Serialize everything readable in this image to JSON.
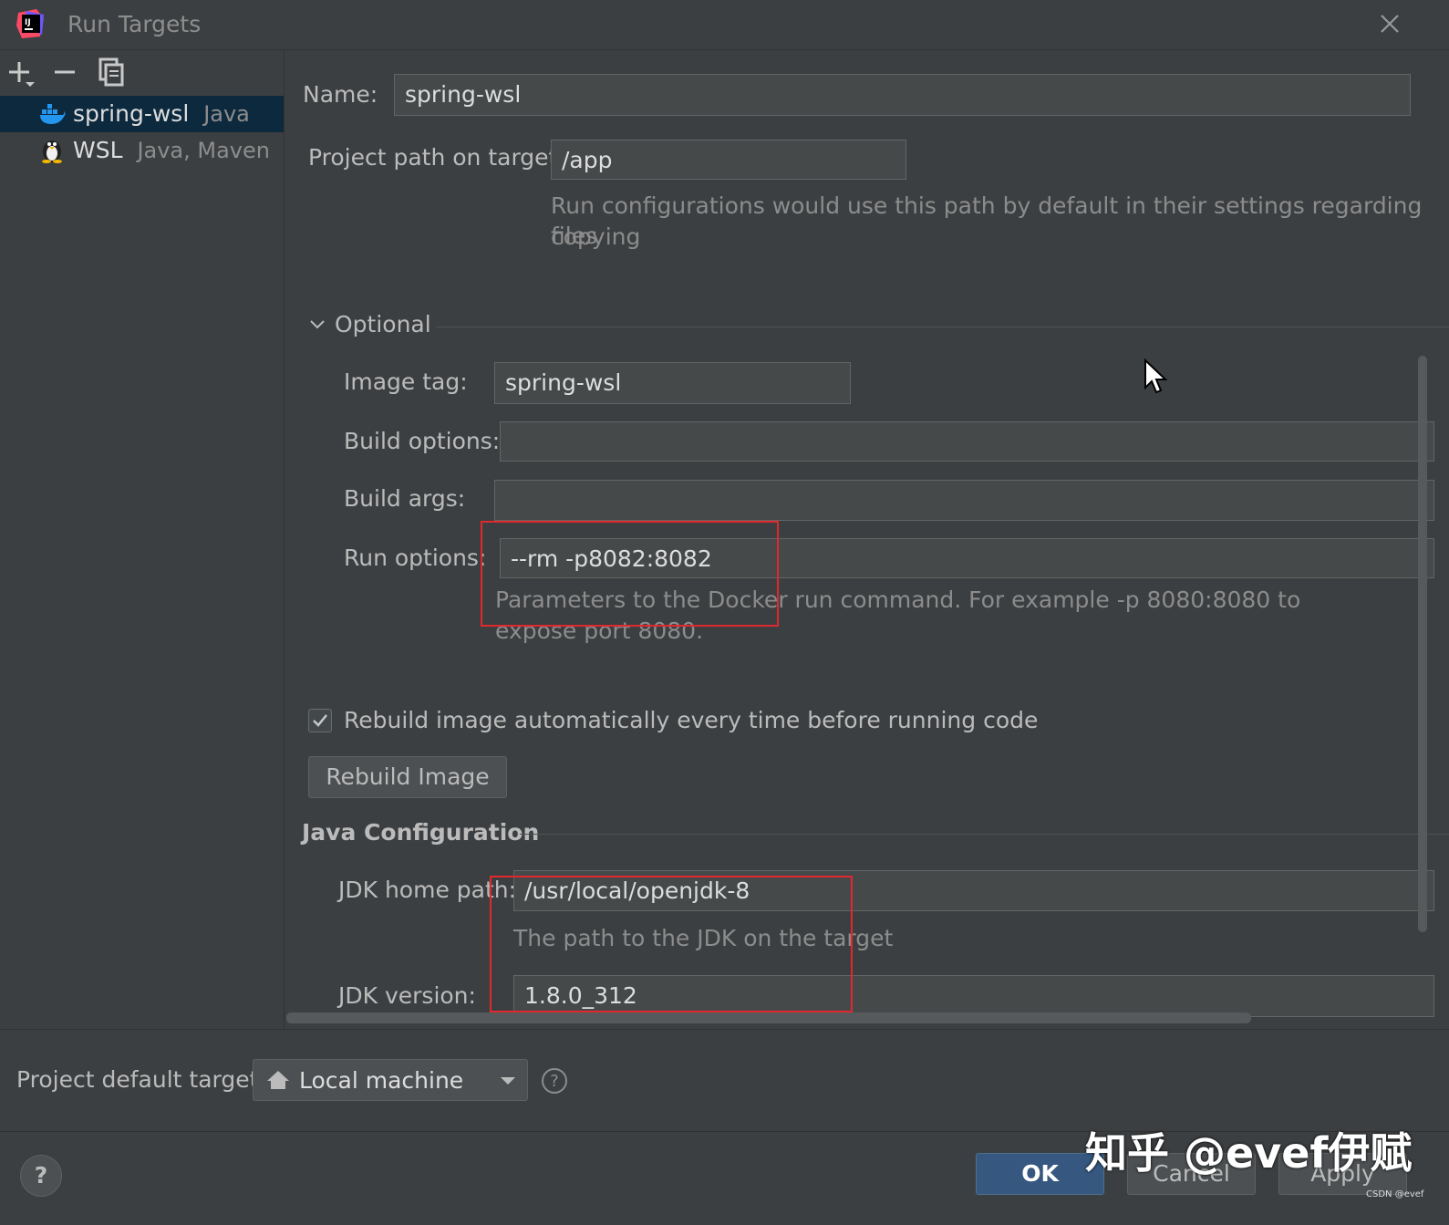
{
  "window": {
    "title": "Run Targets"
  },
  "toolbar": {
    "add": "add-icon",
    "remove": "remove-icon",
    "copy": "copy-icon"
  },
  "targets": [
    {
      "name": "spring-wsl",
      "type": "Java",
      "icon": "docker-icon",
      "selected": true
    },
    {
      "name": "WSL",
      "type": "Java, Maven",
      "icon": "linux-penguin-icon",
      "selected": false
    }
  ],
  "form": {
    "name_label": "Name:",
    "name_value": "spring-wsl",
    "project_path_label": "Project path on target:",
    "project_path_value": "/app",
    "project_path_hint_line1": "Run configurations would use this path by default in their settings regarding copying",
    "project_path_hint_line2": "files",
    "optional_label": "Optional",
    "image_tag_label": "Image tag:",
    "image_tag_value": "spring-wsl",
    "build_options_label": "Build options:",
    "build_options_value": "",
    "build_args_label": "Build args:",
    "build_args_value": "",
    "run_options_label": "Run options:",
    "run_options_value": "--rm  -p8082:8082",
    "run_options_hint_line1": "Parameters to the Docker run command. For example -p 8080:8080 to",
    "run_options_hint_line2": "expose port 8080.",
    "rebuild_checkbox_label": "Rebuild image automatically every time before running code",
    "rebuild_checked": true,
    "rebuild_button": "Rebuild Image",
    "java_config_label": "Java Configuration",
    "jdk_home_label": "JDK home path:",
    "jdk_home_value": "/usr/local/openjdk-8",
    "jdk_home_hint": "The path to the JDK on the target",
    "jdk_version_label": "JDK version:",
    "jdk_version_value": "1.8.0_312"
  },
  "footer": {
    "default_target_label": "Project default target:",
    "default_target_value": "Local machine",
    "ok": "OK",
    "cancel": "Cancel",
    "apply": "Apply",
    "help": "?"
  },
  "watermark": {
    "text": "知乎 @evef伊赋",
    "small": "CSDN @evef"
  },
  "colors": {
    "background": "#3c3f41",
    "field": "#45494a",
    "selection": "#0d293e",
    "accent": "#365880",
    "highlight": "#e0282e"
  }
}
